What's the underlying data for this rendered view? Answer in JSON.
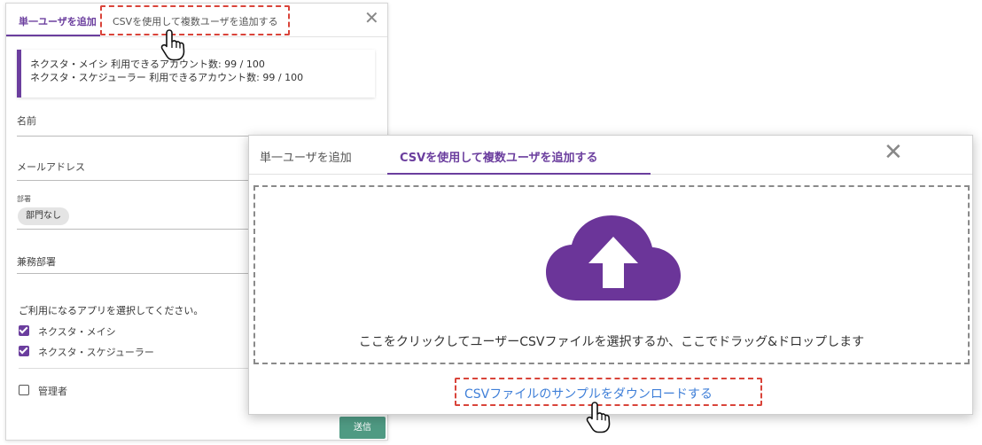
{
  "back_dialog": {
    "tabs": [
      {
        "label": "単一ユーザを追加",
        "active": true
      },
      {
        "label": "CSVを使用して複数ユーザを追加する",
        "active": false
      }
    ],
    "close_glyph": "✕",
    "info": {
      "line1": "ネクスタ・メイシ 利用できるアカウント数: 99 / 100",
      "line2": "ネクスタ・スケジューラー 利用できるアカウント数: 99 / 100"
    },
    "fields": {
      "name_label": "名前",
      "email_label": "メールアドレス",
      "dept_label": "部署",
      "dept_chip": "部門なし",
      "concurrent_dept_label": "兼務部署"
    },
    "apps_title": "ご利用になるアプリを選択してください。",
    "apps": [
      {
        "label": "ネクスタ・メイシ",
        "checked": true
      },
      {
        "label": "ネクスタ・スケジューラー",
        "checked": true
      }
    ],
    "admin": {
      "label": "管理者",
      "checked": false
    },
    "submit_label": "送信"
  },
  "front_dialog": {
    "tabs": [
      {
        "label": "単一ユーザを追加",
        "active": false
      },
      {
        "label": "CSVを使用して複数ユーザを追加する",
        "active": true
      }
    ],
    "close_glyph": "✕",
    "dropzone_text": "ここをクリックしてユーザーCSVファイルを選択するか、ここでドラッグ&ドロップします",
    "sample_link": "CSVファイルのサンプルをダウンロードする"
  },
  "icons": {
    "upload": "cloud-upload-icon",
    "hand_cursor": "hand-pointer-icon"
  },
  "colors": {
    "accent": "#6b3e9e",
    "submit": "#4f9a83",
    "highlight": "#d9443a",
    "link": "#3f7fd8"
  }
}
